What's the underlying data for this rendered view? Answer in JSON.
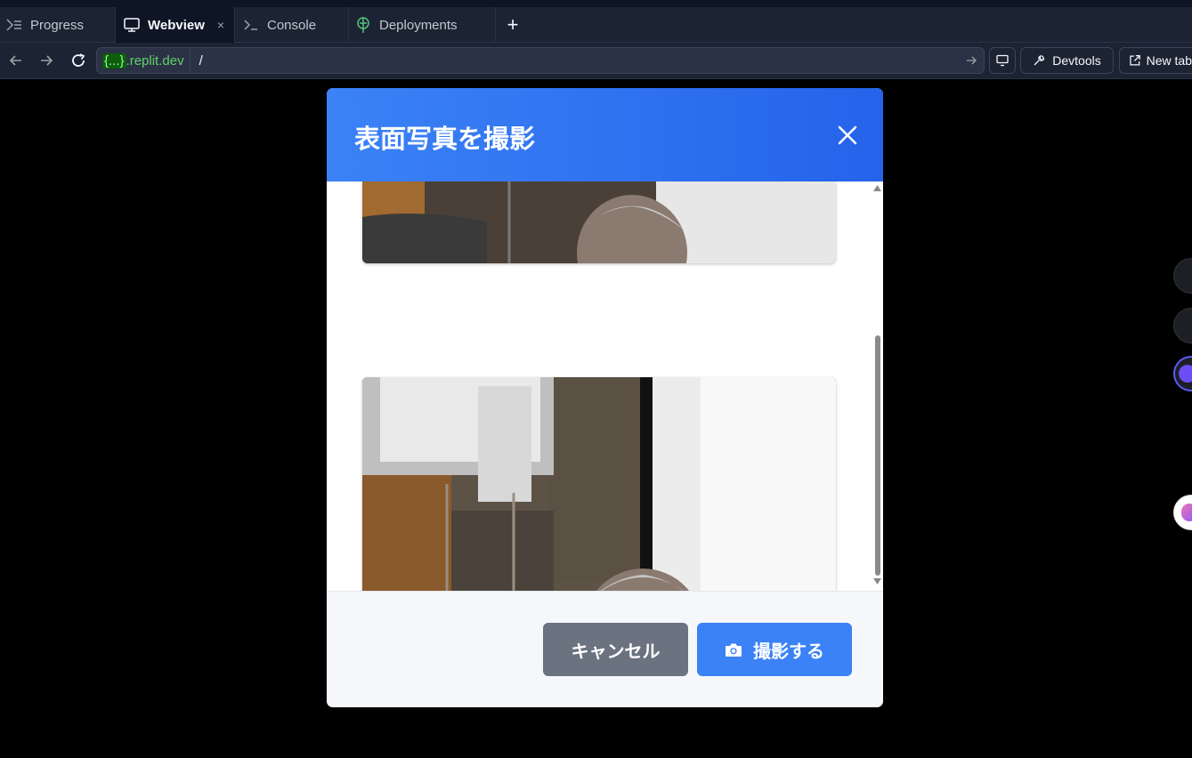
{
  "tabs": [
    {
      "label": "Progress",
      "icon": "progress-icon"
    },
    {
      "label": "Webview",
      "icon": "monitor-icon",
      "active": true,
      "close": "×"
    },
    {
      "label": "Console",
      "icon": "terminal-icon"
    },
    {
      "label": "Deployments",
      "icon": "deployments-icon"
    }
  ],
  "new_tab_label": "+",
  "address_bar": {
    "host_braces": "{...}",
    "host_domain": ".replit.dev",
    "path": "/"
  },
  "toolbar": {
    "devtools_label": "Devtools",
    "new_tab_label": "New tab"
  },
  "modal": {
    "title": "表面写真を撮影",
    "cancel_label": "キャンセル",
    "capture_label": "撮影する"
  },
  "colors": {
    "header_blue": "#3b82f6",
    "cancel_gray": "#6b7280",
    "capture_blue": "#3b82f6"
  }
}
